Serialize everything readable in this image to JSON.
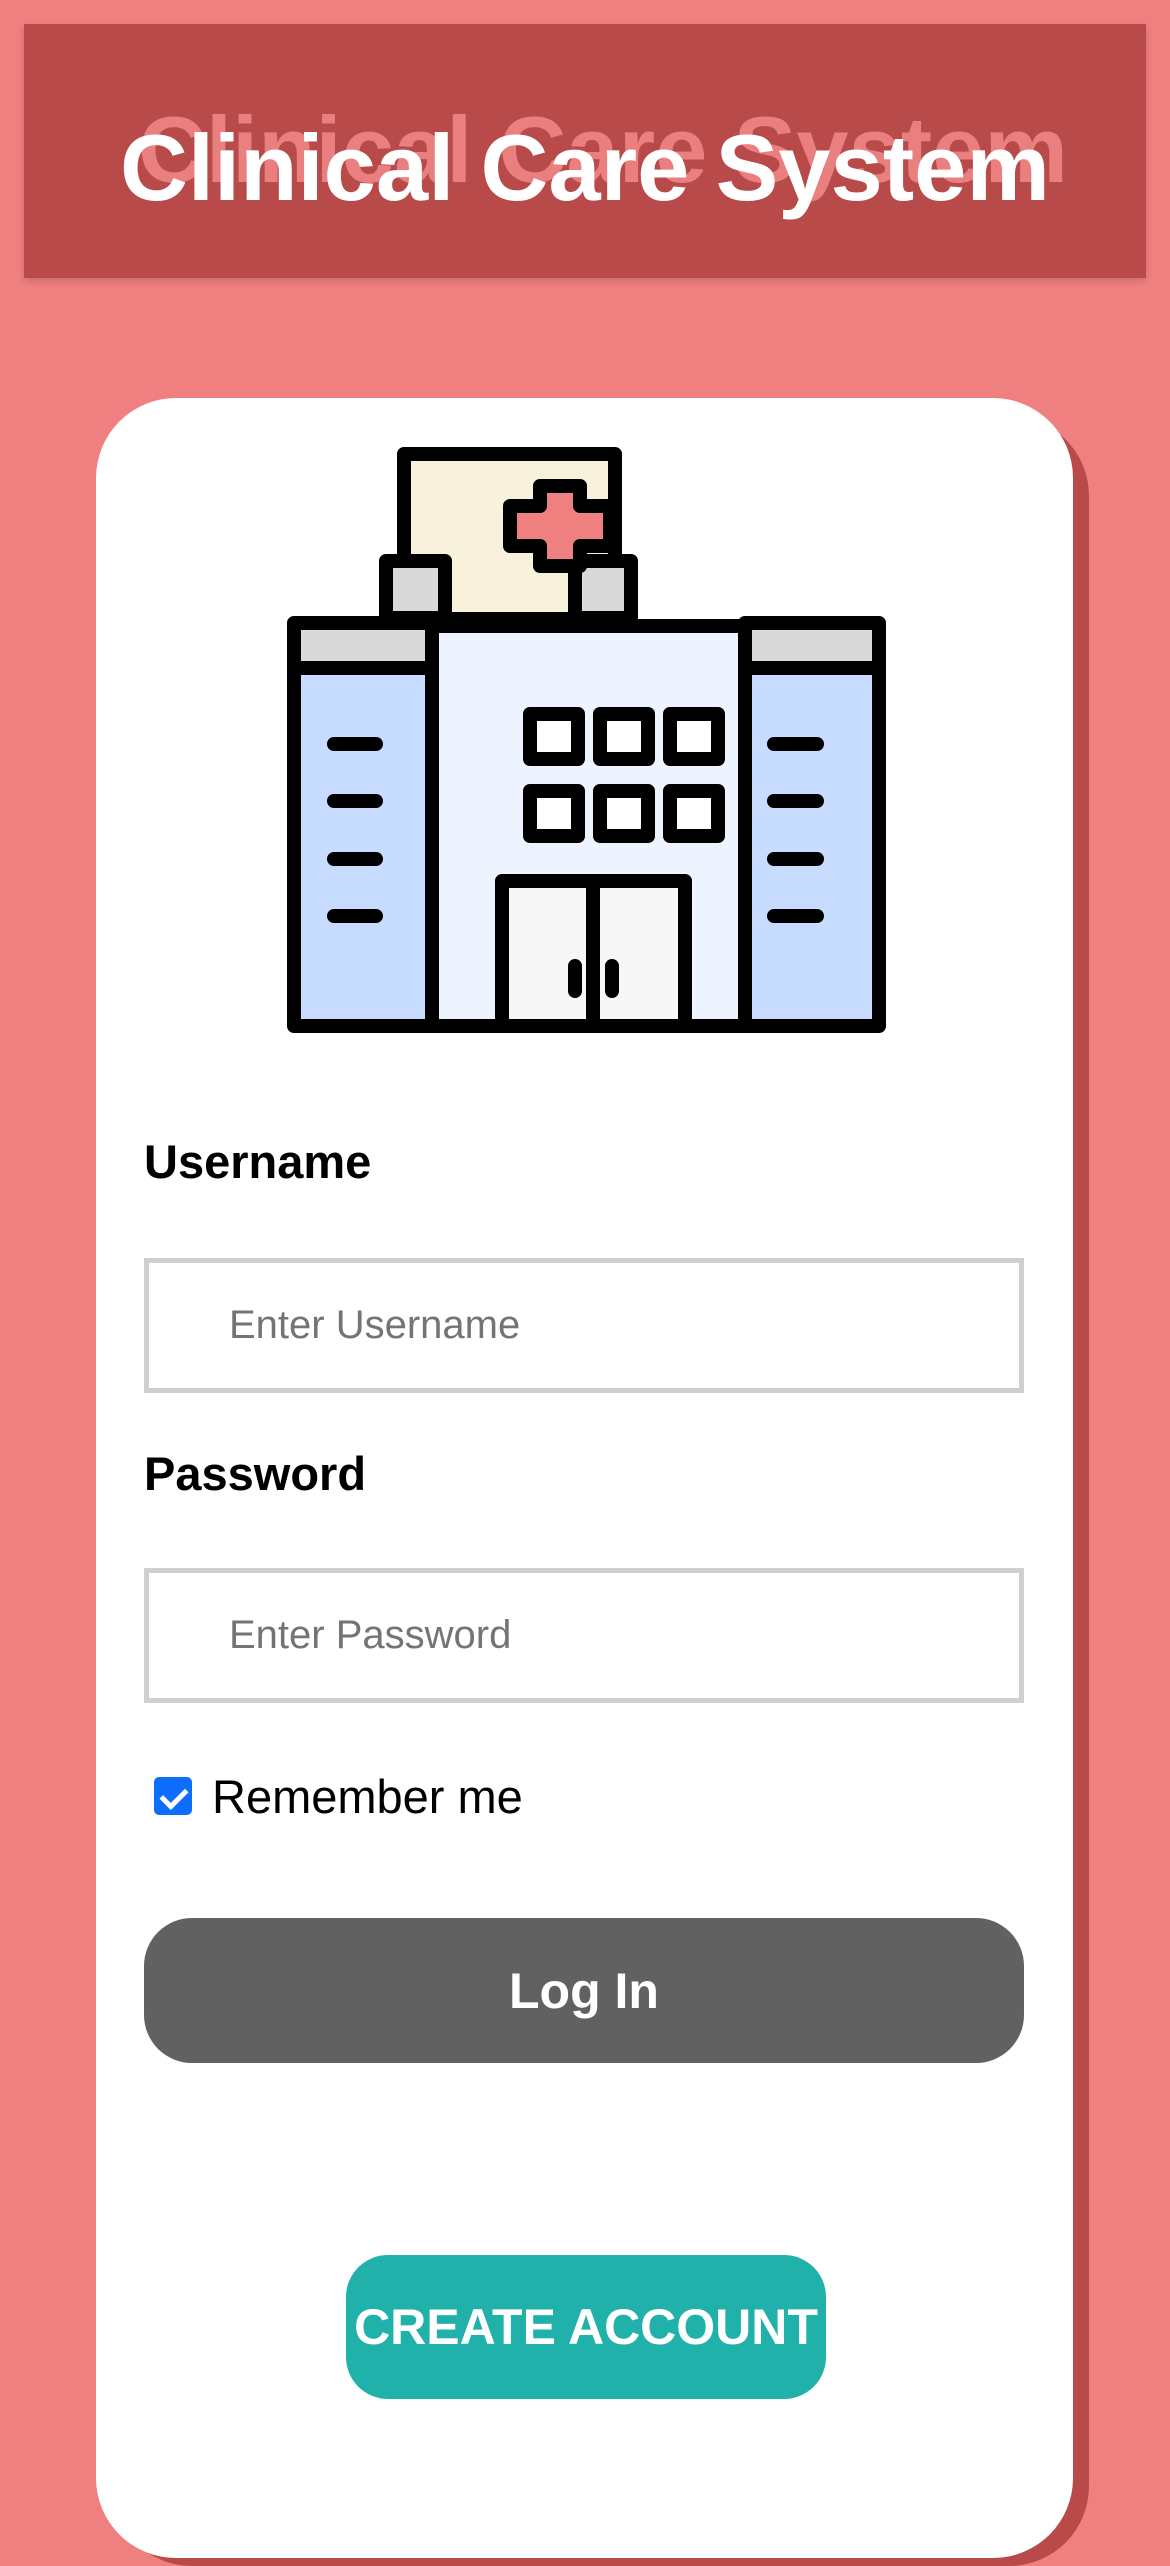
{
  "header": {
    "title": "Clinical Care System"
  },
  "login_card": {
    "username_label": "Username",
    "username_placeholder": "Enter Username",
    "password_label": "Password",
    "password_placeholder": "Enter Password",
    "remember_label": "Remember me",
    "remember_checked": true,
    "login_button": "Log In",
    "create_account_button": "CREATE ACCOUNT"
  },
  "icons": {
    "hospital": "hospital-icon"
  },
  "colors": {
    "background": "#f07f7f",
    "header": "#b84a4a",
    "login_button": "#616161",
    "create_account_button": "#20b2aa"
  }
}
